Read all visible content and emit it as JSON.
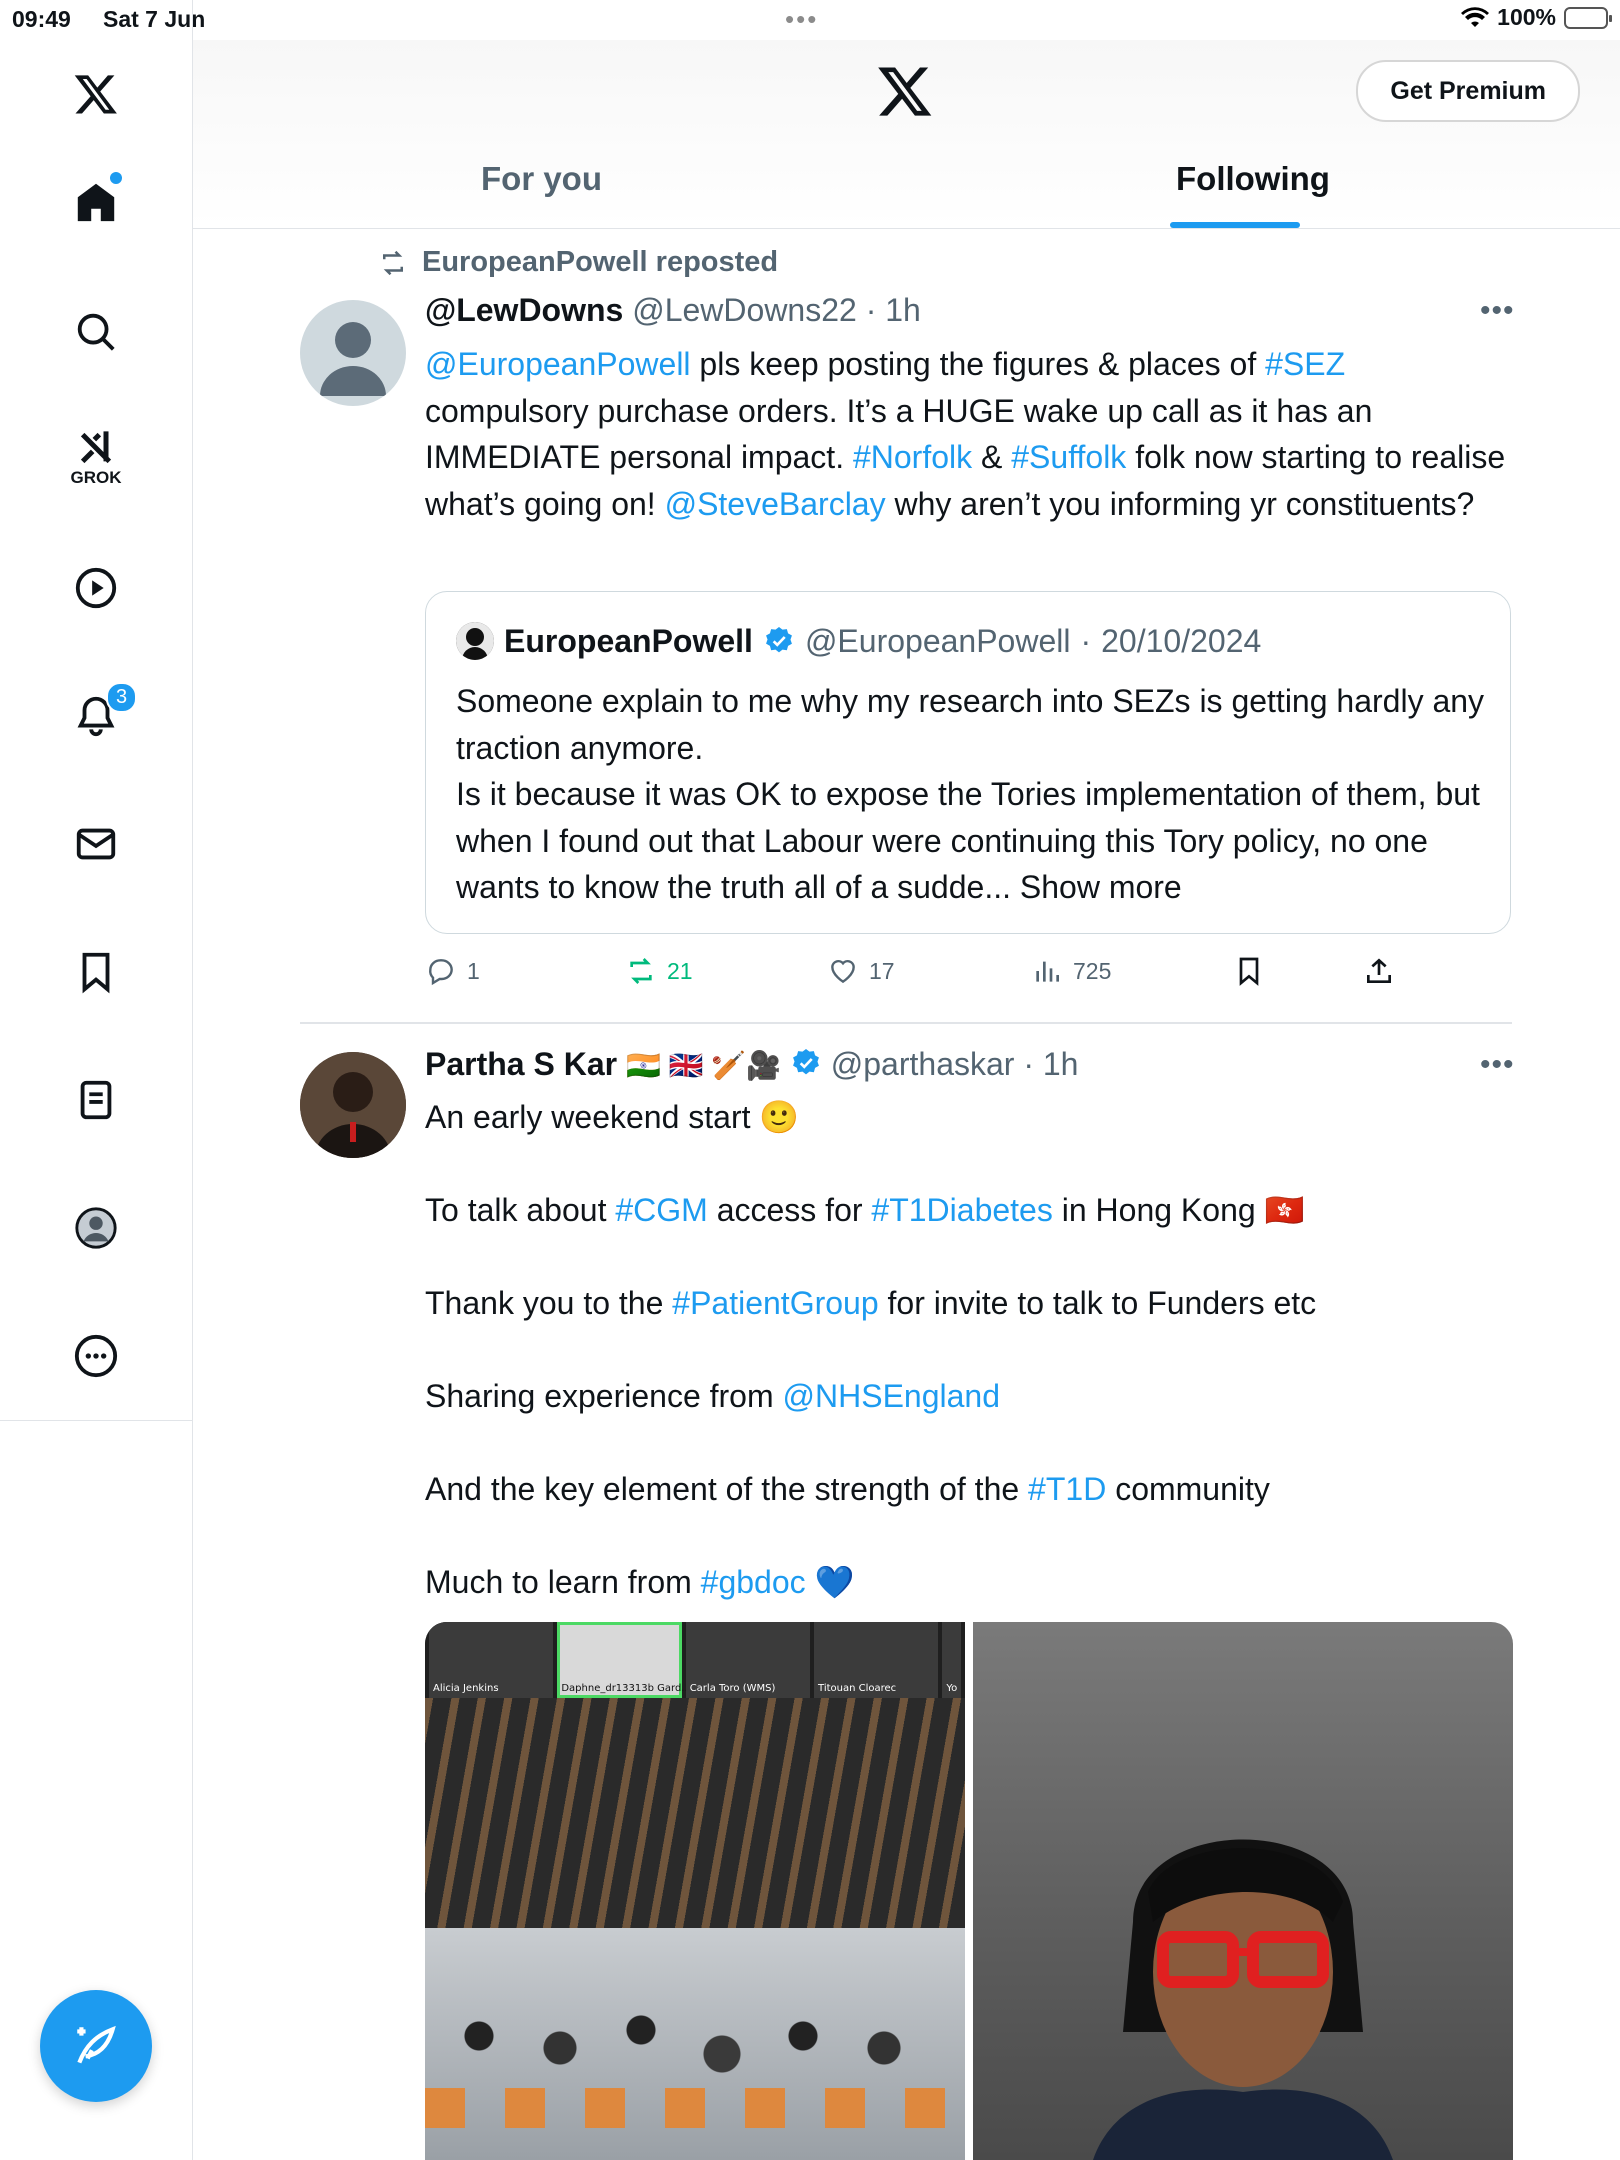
{
  "status_bar": {
    "time": "09:49",
    "date": "Sat 7 Jun",
    "battery": "100%"
  },
  "colors": {
    "accent": "#1d9bf0",
    "text": "#0f1419",
    "muted": "#536471",
    "repost_green": "#00ba7c"
  },
  "sidebar": {
    "items": [
      {
        "icon": "x-logo-icon"
      },
      {
        "icon": "home-icon"
      },
      {
        "icon": "search-icon"
      },
      {
        "icon": "grok-icon",
        "label": "GROK"
      },
      {
        "icon": "video-play-icon"
      },
      {
        "icon": "notifications-icon",
        "badge": "3"
      },
      {
        "icon": "messages-icon"
      },
      {
        "icon": "bookmarks-icon"
      },
      {
        "icon": "lists-icon"
      },
      {
        "icon": "profile-avatar-icon"
      },
      {
        "icon": "more-icon"
      }
    ],
    "compose_icon": "compose-post-icon"
  },
  "header": {
    "premium_label": "Get Premium",
    "tabs": [
      {
        "label": "For you"
      },
      {
        "label": "Following"
      }
    ],
    "active_tab": "Following"
  },
  "tweets": [
    {
      "repost_by": "EuropeanPowell reposted",
      "display_name": "@LewDowns",
      "handle": "@LewDowns22",
      "time": "1h",
      "text_parts": [
        {
          "t": "@EuropeanPowell",
          "link": true
        },
        {
          "t": " pls keep posting the figures & places of "
        },
        {
          "t": "#SEZ",
          "link": true
        },
        {
          "t": " compulsory purchase orders. It’s a HUGE wake up call as it has an IMMEDIATE personal impact. "
        },
        {
          "t": "#Norfolk",
          "link": true
        },
        {
          "t": " & "
        },
        {
          "t": "#Suffolk",
          "link": true
        },
        {
          "t": " folk now starting to realise what’s going on! "
        },
        {
          "t": "@SteveBarclay",
          "link": true
        },
        {
          "t": " why aren’t you informing yr constituents?"
        }
      ],
      "quote": {
        "display_name": "EuropeanPowell",
        "handle": "@EuropeanPowell",
        "date": "20/10/2024",
        "line1": "Someone explain to me why my research into SEZs is getting hardly any traction anymore.",
        "line2": "Is it because it was OK to expose the Tories implementation of them, but when I found out that Labour were continuing this Tory policy, no one wants to know the truth all of a sudde...",
        "show_more": "Show more"
      },
      "stats": {
        "replies": "1",
        "reposts": "21",
        "likes": "17",
        "views": "725"
      }
    },
    {
      "display_name": "Partha S Kar",
      "name_emojis": "🇮🇳 🇬🇧 🏏🎥",
      "handle": "@parthaskar",
      "time": "1h",
      "paragraphs": [
        [
          {
            "t": "An early weekend start 🙂"
          }
        ],
        [
          {
            "t": "To talk about "
          },
          {
            "t": "#CGM",
            "link": true
          },
          {
            "t": " access for "
          },
          {
            "t": "#T1Diabetes",
            "link": true
          },
          {
            "t": " in Hong Kong 🇭🇰"
          }
        ],
        [
          {
            "t": "Thank you to the "
          },
          {
            "t": "#PatientGroup",
            "link": true
          },
          {
            "t": " for invite to talk to Funders etc"
          }
        ],
        [
          {
            "t": "Sharing experience from "
          },
          {
            "t": "@NHSEngland",
            "link": true
          }
        ],
        [
          {
            "t": "And the key element of the strength of the "
          },
          {
            "t": "#T1D",
            "link": true
          },
          {
            "t": " community"
          }
        ],
        [
          {
            "t": "Much to learn from "
          },
          {
            "t": "#gbdoc",
            "link": true
          },
          {
            "t": " 💙"
          }
        ]
      ],
      "media_zoom_names": [
        "Alicia Jenkins",
        "Daphne_dr13313b Gard...",
        "Carla Toro (WMS)",
        "Titouan Cloarec",
        "Yo"
      ]
    }
  ]
}
